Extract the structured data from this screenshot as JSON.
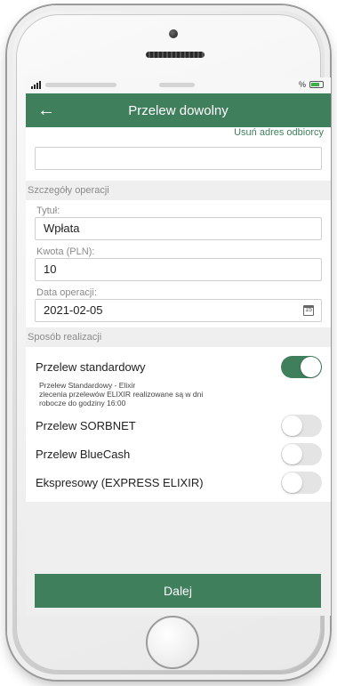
{
  "status_bar": {
    "battery_text": "%"
  },
  "header": {
    "title": "Przelew dowolny"
  },
  "recipient": {
    "remove_address_link": "Usuń adres odbiorcy"
  },
  "operation_details": {
    "section_label": "Szczegóły operacji",
    "title_label": "Tytuł:",
    "title_value": "Wpłata",
    "amount_label": "Kwota (PLN):",
    "amount_value": "10",
    "date_label": "Data operacji:",
    "date_value": "2021-02-05",
    "calendar_icon_text": "15"
  },
  "execution": {
    "section_label": "Sposób realizacji",
    "options": [
      {
        "label": "Przelew standardowy",
        "enabled": true
      },
      {
        "label": "Przelew SORBNET",
        "enabled": false
      },
      {
        "label": "Przelew BlueCash",
        "enabled": false
      },
      {
        "label": "Ekspresowy (EXPRESS ELIXIR)",
        "enabled": false
      }
    ],
    "standard_note_line1": "Przelew Standardowy - Elixir",
    "standard_note_line2": "zlecenia przelewów ELIXIR realizowane są w dni",
    "standard_note_line3": "robocze do godziny 16:00"
  },
  "footer": {
    "next_button": "Dalej"
  },
  "colors": {
    "accent": "#3f7f5c",
    "background": "#efefef"
  }
}
